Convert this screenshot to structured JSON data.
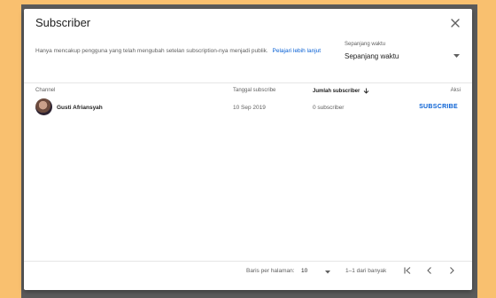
{
  "dialog": {
    "title": "Subscriber",
    "description": "Hanya mencakup pengguna yang telah mengubah setelan subscription-nya menjadi publik.",
    "learn_more": "Pelajari lebih lanjut",
    "period": {
      "label": "Sepanjang waktu",
      "value": "Sepanjang waktu"
    }
  },
  "table": {
    "columns": {
      "channel": "Channel",
      "date": "Tanggal subscribe",
      "subs": "Jumlah subscriber",
      "action": "Aksi"
    },
    "rows": [
      {
        "name": "Gusti Afriansyah",
        "date": "10 Sep 2019",
        "subs": "0 subscriber",
        "action": "SUBSCRIBE"
      }
    ]
  },
  "footer": {
    "rows_per_page_label": "Baris per halaman:",
    "rows_per_page_value": "10",
    "range": "1–1 dari banyak"
  },
  "colors": {
    "accent": "#065fd4",
    "background": "#f9c06f"
  }
}
